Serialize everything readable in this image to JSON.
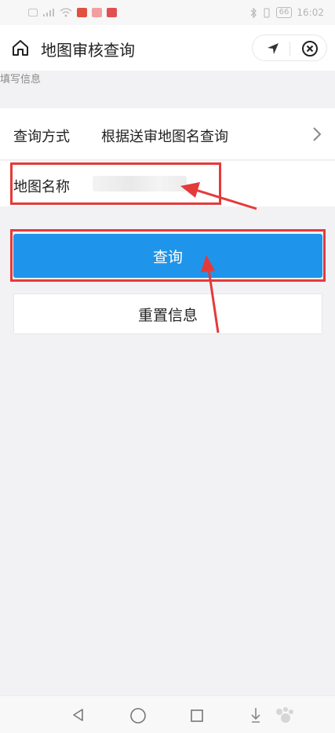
{
  "status_bar": {
    "time": "16:02",
    "battery": "66",
    "icons": [
      "hd-icon",
      "signal-icon",
      "wifi-icon",
      "app-notification-icon",
      "app-notification-icon",
      "bluetooth-icon",
      "vibrate-icon",
      "battery-icon"
    ]
  },
  "header": {
    "title": "地图审核查询",
    "home_icon": "home-icon",
    "location_icon": "location-arrow-icon",
    "close_icon": "close-circle-icon"
  },
  "form": {
    "section_caption": "填写信息",
    "query_method_label": "查询方式",
    "query_method_value": "根据送审地图名查询",
    "map_name_label": "地图名称",
    "map_name_value": ""
  },
  "buttons": {
    "query": "查询",
    "reset": "重置信息"
  },
  "annotations": {
    "color": "#e53a3a"
  },
  "nav_bar": {
    "icons": [
      "back-icon",
      "home-circle-icon",
      "recent-apps-icon",
      "down-arrow-icon"
    ]
  },
  "colors": {
    "primary": "#1e95ea",
    "background": "#f2f2f4"
  }
}
